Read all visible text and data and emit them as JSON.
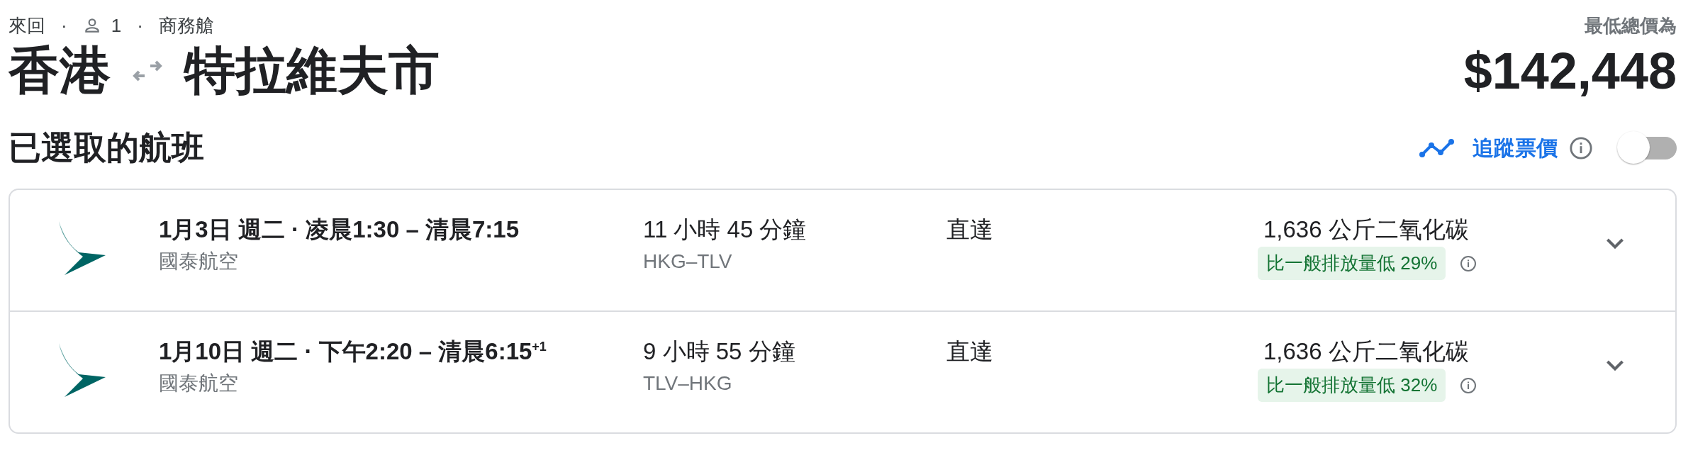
{
  "trip": {
    "type": "來回",
    "separators": [
      "·",
      "·"
    ],
    "passengers": "1",
    "cabin": "商務艙"
  },
  "route": {
    "origin": "香港",
    "destination": "特拉維夫市"
  },
  "price": {
    "label": "最低總價為",
    "amount": "$142,448"
  },
  "section_title": "已選取的航班",
  "track_prices": {
    "label": "追蹤票價",
    "on": false
  },
  "flights": [
    {
      "schedule": "1月3日 週二 · 凌晨1:30 – 清晨7:15",
      "airline": "國泰航空",
      "duration": "11 小時 45 分鐘",
      "route": "HKG–TLV",
      "stops": "直達",
      "emissions": "1,636 公斤二氧化碳",
      "emissions_badge": "比一般排放量低 29%",
      "expanded": false
    },
    {
      "schedule": "1月10日 週二 · 下午2:20 – 清晨6:15$^{+1}$",
      "airline": "國泰航空",
      "duration": "9 小時 55 分鐘",
      "route": "TLV–HKG",
      "stops": "直達",
      "emissions": "1,636 公斤二氧化碳",
      "emissions_badge": "比一般排放量低 32%",
      "expanded": false
    }
  ]
}
